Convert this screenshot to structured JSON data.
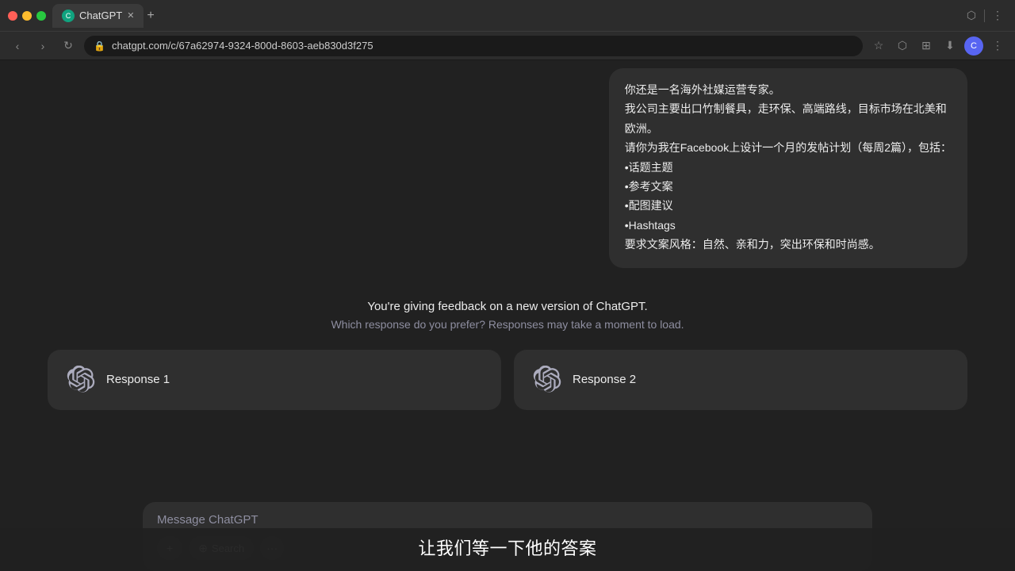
{
  "browser": {
    "tab_title": "ChatGPT",
    "tab_icon": "C",
    "url": "chatgpt.com/c/67a62974-9324-800d-8603-aeb830d3f275",
    "nav_back": "←",
    "nav_forward": "→",
    "nav_refresh": "↻",
    "lock_icon": "🔒",
    "add_tab": "+",
    "avatar_label": "C"
  },
  "conversation": {
    "user_message_lines": [
      "你还是一名海外社媒运营专家。",
      "我公司主要出口竹制餐具，走环保、高端路线，目标市场在北美和",
      "欧洲。",
      "请你为我在Facebook上设计一个月的发帖计划（每周2篇），包括：",
      "•话题主题",
      "•参考文案",
      "•配图建议",
      "•Hashtags",
      "要求文案风格：自然、亲和力，突出环保和时尚感。"
    ]
  },
  "feedback": {
    "title": "You're giving feedback on a new version of ChatGPT.",
    "subtitle": "Which response do you prefer? Responses may take a moment to load."
  },
  "responses": [
    {
      "label": "Response 1"
    },
    {
      "label": "Response 2"
    }
  ],
  "input": {
    "placeholder": "Message ChatGPT",
    "add_btn": "+",
    "search_btn": "Search",
    "more_btn": "···"
  },
  "subtitle": {
    "text": "让我们等一下他的答案"
  }
}
